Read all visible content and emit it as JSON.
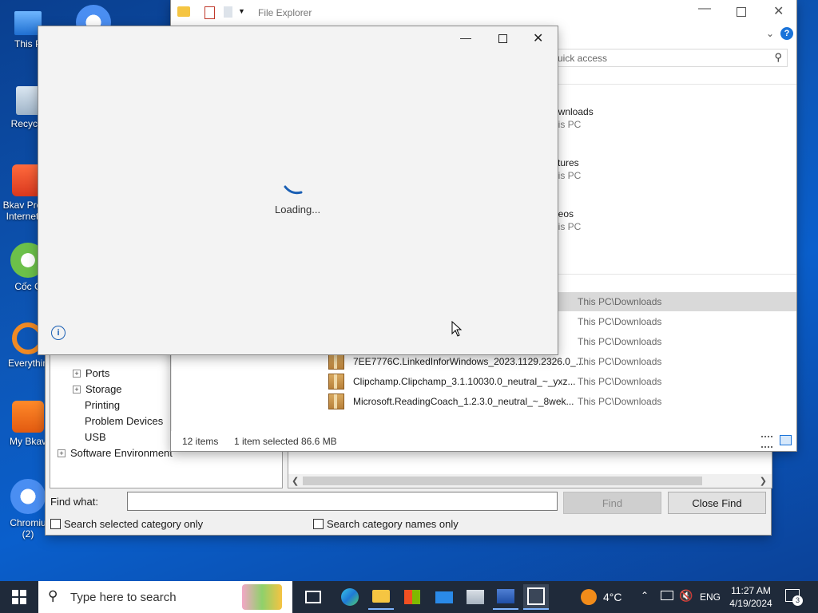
{
  "desktop": {
    "icons": [
      {
        "label": "This P"
      },
      {
        "label": "Recycle"
      },
      {
        "label": "Bkav Pro Internet"
      },
      {
        "label": "Cốc C"
      },
      {
        "label": "Everythin"
      },
      {
        "label": "My Bkav"
      },
      {
        "label": "Chromiu (2)"
      }
    ]
  },
  "explorer": {
    "title": "File Explorer",
    "search_placeholder": "uick access",
    "quick_access": [
      {
        "name": "ownloads",
        "location": "his PC"
      },
      {
        "name": "ctures",
        "location": "his PC"
      },
      {
        "name": "deos",
        "location": "his PC"
      }
    ],
    "recent_files": [
      {
        "name": "",
        "path": "This PC\\Downloads"
      },
      {
        "name": "",
        "path": "This PC\\Downloads"
      },
      {
        "name": "",
        "path": "This PC\\Downloads"
      },
      {
        "name": "7EE7776C.LinkedInforWindows_2023.1129.2326.0_...",
        "path": "This PC\\Downloads"
      },
      {
        "name": "Clipchamp.Clipchamp_3.1.10030.0_neutral_~_yxz...",
        "path": "This PC\\Downloads"
      },
      {
        "name": "Microsoft.ReadingCoach_1.2.3.0_neutral_~_8wek...",
        "path": "This PC\\Downloads"
      }
    ],
    "status": {
      "items": "12 items",
      "selected": "1 item selected",
      "size": "86.6 MB"
    }
  },
  "sysinfo": {
    "tree": [
      {
        "label": "Ports",
        "expandable": true
      },
      {
        "label": "Storage",
        "expandable": true
      },
      {
        "label": "Printing",
        "expandable": false
      },
      {
        "label": "Problem Devices",
        "expandable": false
      },
      {
        "label": "USB",
        "expandable": false
      },
      {
        "label": "Software Environment",
        "expandable": true
      }
    ],
    "find_label": "Find what:",
    "find_value": "",
    "find_button": "Find",
    "close_find_button": "Close Find",
    "check1": "Search selected category only",
    "check2": "Search category names only"
  },
  "dialog": {
    "loading_text": "Loading..."
  },
  "taskbar": {
    "search_placeholder": "Type here to search",
    "weather": "4°C",
    "language": "ENG",
    "time": "11:27 AM",
    "date": "4/19/2024",
    "notification_count": "3"
  },
  "colors": {
    "accent": "#0a5fcc",
    "selected_row": "#cce8ff",
    "spinner": "#1a5fb4"
  }
}
